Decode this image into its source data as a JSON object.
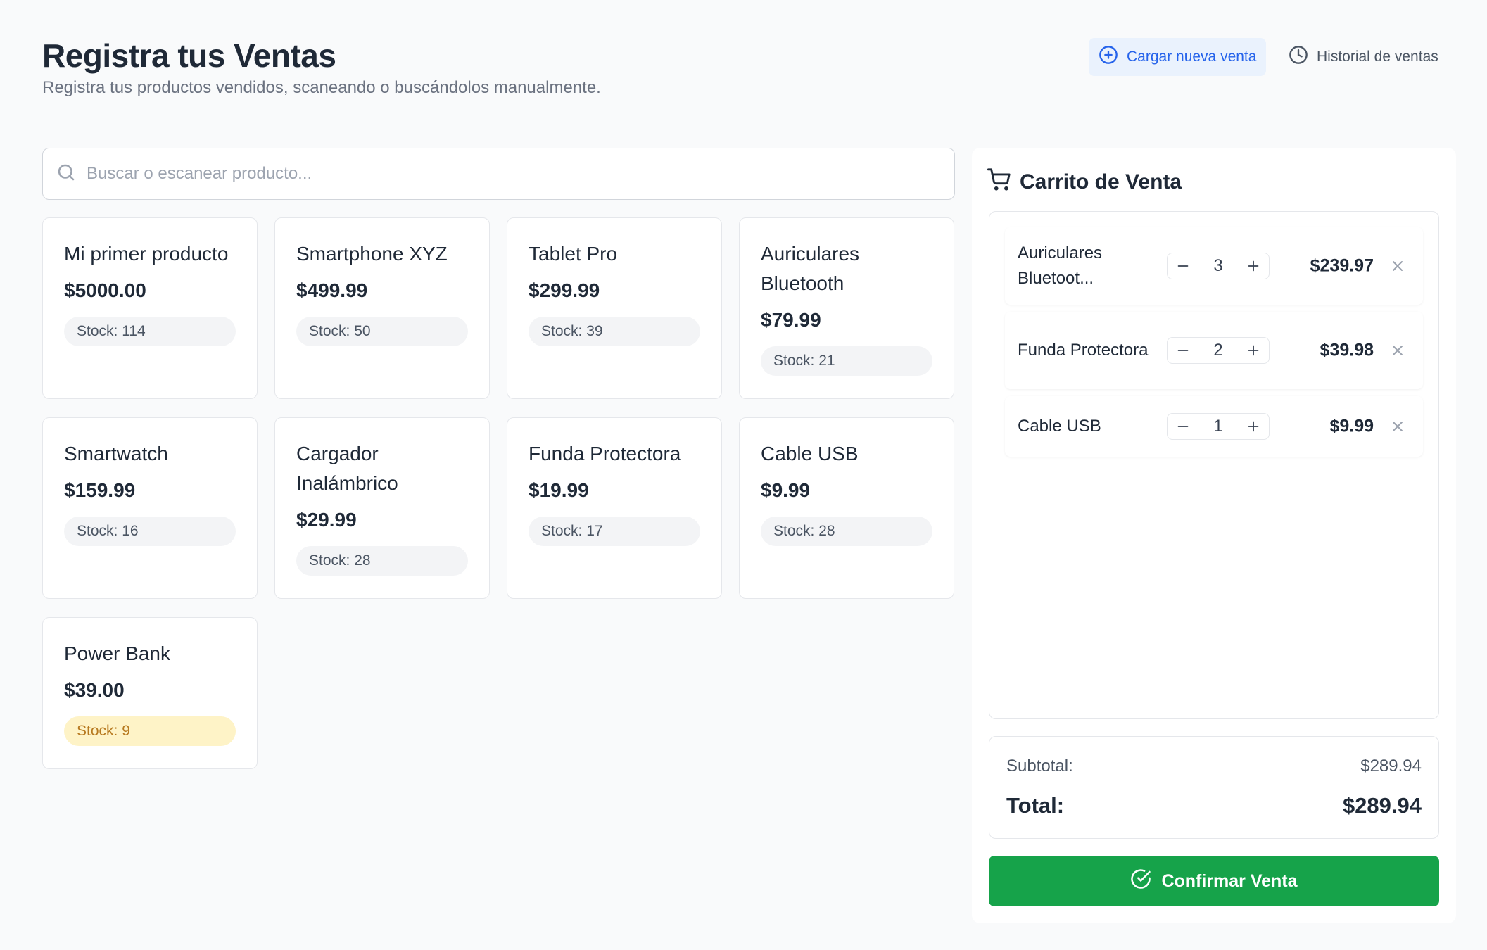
{
  "header": {
    "title": "Registra tus Ventas",
    "subtitle": "Registra tus productos vendidos, scaneando o buscándolos manualmente.",
    "new_sale_label": "Cargar nueva venta",
    "history_label": "Historial de ventas"
  },
  "search": {
    "placeholder": "Buscar o escanear producto...",
    "value": ""
  },
  "products": [
    {
      "name": "Mi primer producto",
      "price": "$5000.00",
      "stock": "Stock: 114",
      "low": false
    },
    {
      "name": "Smartphone XYZ",
      "price": "$499.99",
      "stock": "Stock: 50",
      "low": false
    },
    {
      "name": "Tablet Pro",
      "price": "$299.99",
      "stock": "Stock: 39",
      "low": false
    },
    {
      "name": "Auriculares Bluetooth",
      "price": "$79.99",
      "stock": "Stock: 21",
      "low": false
    },
    {
      "name": "Smartwatch",
      "price": "$159.99",
      "stock": "Stock: 16",
      "low": false
    },
    {
      "name": "Cargador Inalámbrico",
      "price": "$29.99",
      "stock": "Stock: 28",
      "low": false
    },
    {
      "name": "Funda Protectora",
      "price": "$19.99",
      "stock": "Stock: 17",
      "low": false
    },
    {
      "name": "Cable USB",
      "price": "$9.99",
      "stock": "Stock: 28",
      "low": false
    },
    {
      "name": "Power Bank",
      "price": "$39.00",
      "stock": "Stock: 9",
      "low": true
    }
  ],
  "cart": {
    "title": "Carrito de Venta",
    "items": [
      {
        "name": "Auriculares Bluetoot...",
        "qty": "3",
        "total": "$239.97"
      },
      {
        "name": "Funda Protectora",
        "qty": "2",
        "total": "$39.98"
      },
      {
        "name": "Cable USB",
        "qty": "1",
        "total": "$9.99"
      }
    ],
    "subtotal_label": "Subtotal:",
    "subtotal_value": "$289.94",
    "total_label": "Total:",
    "total_value": "$289.94",
    "confirm_label": "Confirmar Venta"
  },
  "colors": {
    "accent": "#2563eb",
    "confirm": "#16a34a",
    "low_stock_bg": "#fef3c7",
    "low_stock_text": "#b7791f"
  },
  "icons": {
    "new_sale": "plus-circle-icon",
    "history": "clock-icon",
    "search": "search-icon",
    "cart": "cart-icon",
    "remove": "close-icon",
    "decrement": "minus-icon",
    "increment": "plus-icon",
    "confirm": "check-circle-icon"
  }
}
